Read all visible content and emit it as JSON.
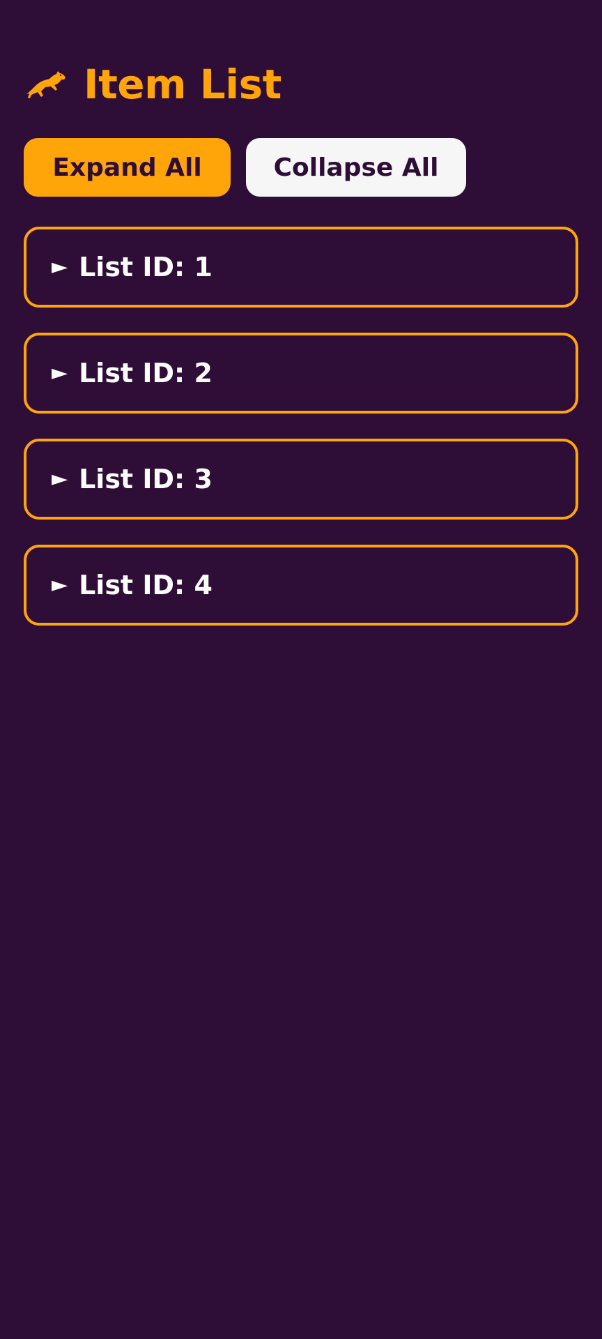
{
  "header": {
    "title": "Item List",
    "logo_icon": "leaping-dog-icon"
  },
  "toolbar": {
    "expand_label": "Expand All",
    "collapse_label": "Collapse All"
  },
  "list": {
    "items": [
      {
        "arrow": "►",
        "label": "List ID: 1"
      },
      {
        "arrow": "►",
        "label": "List ID: 2"
      },
      {
        "arrow": "►",
        "label": "List ID: 3"
      },
      {
        "arrow": "►",
        "label": "List ID: 4"
      }
    ]
  },
  "colors": {
    "background": "#2e0d36",
    "accent": "#ffa50a",
    "secondary_button": "#f6f6f6",
    "item_text": "#ffffff"
  }
}
